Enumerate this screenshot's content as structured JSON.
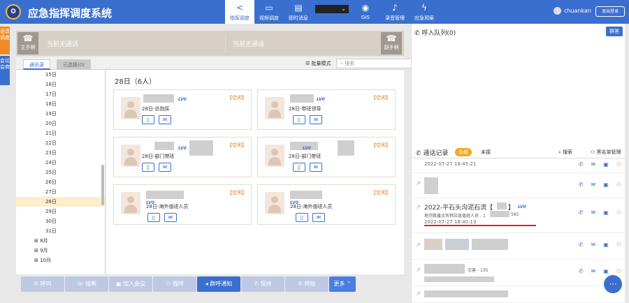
{
  "app": {
    "logo_text": "✪",
    "title": "应急指挥调度系统"
  },
  "nav": [
    {
      "label": "指挥调度",
      "active": true
    },
    {
      "label": "视频调度"
    },
    {
      "label": "即时消息"
    },
    {
      "label": "GIS"
    },
    {
      "label": "录音管理"
    },
    {
      "label": "应急预案"
    }
  ],
  "user": {
    "name": "chuankan",
    "logout": "退出登录"
  },
  "side_tabs": [
    "语音调度",
    "会议会商"
  ],
  "call_panel": {
    "main_phone": "主手柄",
    "aux_phone": "副手柄",
    "left_state": "当前无通话",
    "right_state": "当前无通话"
  },
  "tabs": {
    "contacts": "通讯录",
    "selected": "已选择(0)",
    "batch": "批量模式",
    "search_placeholder": "搜索"
  },
  "tree": {
    "days": [
      "15日",
      "16日",
      "17日",
      "18日",
      "19日",
      "20日",
      "21日",
      "22日",
      "23日",
      "24日",
      "25日",
      "26日",
      "27日",
      "28日",
      "29日",
      "30日",
      "31日"
    ],
    "selected": "28日",
    "months": [
      "8月",
      "9月",
      "10月"
    ]
  },
  "group_title": "28日（6人）",
  "cards": [
    {
      "level": "LV0",
      "status": "【空闲】",
      "dept": "28日-总指挥"
    },
    {
      "level": "LV0",
      "status": "【空闲】",
      "dept": "28日-带班领导"
    },
    {
      "level": "LV0",
      "status": "【空闲】",
      "dept": "28日-部门带班"
    },
    {
      "level": "LV0",
      "status": "【空闲】",
      "dept": "28日-部门带班"
    },
    {
      "level": "LV0",
      "status": "【空闲】",
      "dept": "28日-海外值班人员"
    },
    {
      "level": "LV0",
      "status": "【空闲】",
      "dept": "28日-海外值班人员"
    }
  ],
  "toolbar": [
    "呼叫",
    "挂断",
    "加入会议",
    "强呼",
    "群呼通知",
    "保持",
    "转接",
    "更多"
  ],
  "right": {
    "queue_title": "呼入队列(0)",
    "group_btn": "群答",
    "records_title": "通话记录",
    "all": "全部",
    "unanswered": "未接",
    "search": "搜索",
    "blacklist": "黑名单管理",
    "records": [
      {
        "time": "2022-07-27 18:45:21"
      },
      {
        "title": "2022-平石头沟泥石流【"
      },
      {
        "level": "LV0",
        "detail": "地河救援点名称应急值班人员 - 1",
        "phone_tail": "565",
        "time": "2022-07-27 18:40:13"
      },
      {
        "extra": "灾害 - 135"
      }
    ]
  }
}
